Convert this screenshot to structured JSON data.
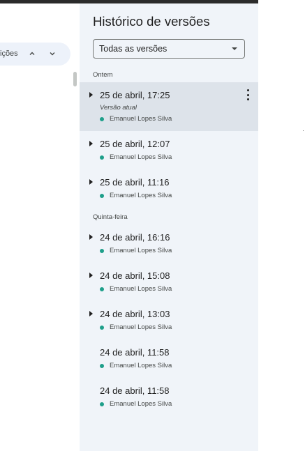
{
  "find_bar": {
    "text": "ições",
    "prev_icon": "chevron-up-icon",
    "next_icon": "chevron-down-icon"
  },
  "panel": {
    "title": "Histórico de versões",
    "filter": {
      "value": "Todas as versões",
      "icon": "dropdown-caret-icon"
    }
  },
  "groups": [
    {
      "label": "Ontem",
      "versions": [
        {
          "date": "25 de abril, 17:25",
          "current_label": "Versão atual",
          "author": "Emanuel Lopes Silva",
          "expandable": true,
          "selected": true
        },
        {
          "date": "25 de abril, 12:07",
          "author": "Emanuel Lopes Silva",
          "expandable": true,
          "selected": false
        },
        {
          "date": "25 de abril, 11:16",
          "author": "Emanuel Lopes Silva",
          "expandable": true,
          "selected": false
        }
      ]
    },
    {
      "label": "Quinta-feira",
      "versions": [
        {
          "date": "24 de abril, 16:16",
          "author": "Emanuel Lopes Silva",
          "expandable": true,
          "selected": false
        },
        {
          "date": "24 de abril, 15:08",
          "author": "Emanuel Lopes Silva",
          "expandable": true,
          "selected": false
        },
        {
          "date": "24 de abril, 13:03",
          "author": "Emanuel Lopes Silva",
          "expandable": true,
          "selected": false
        },
        {
          "date": "24 de abril, 11:58",
          "author": "Emanuel Lopes Silva",
          "expandable": false,
          "selected": false
        },
        {
          "date": "24 de abril, 11:58",
          "author": "Emanuel Lopes Silva",
          "expandable": false,
          "selected": false
        }
      ]
    }
  ],
  "colors": {
    "panel_bg": "#f0f4f9",
    "selected_bg": "#dde3ea",
    "author_dot": "#1e9f8a"
  }
}
